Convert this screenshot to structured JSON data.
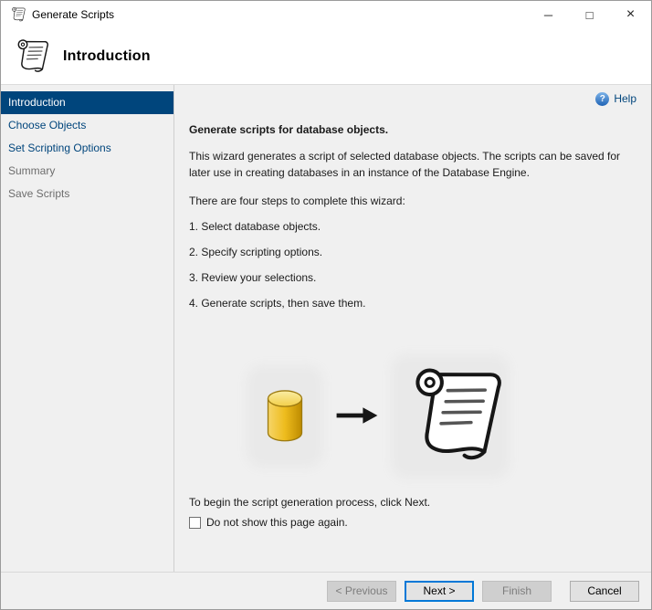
{
  "window": {
    "title": "Generate Scripts"
  },
  "icons": {
    "minimize": "─",
    "maximize": "□",
    "close": "×",
    "help_glyph": "?"
  },
  "header": {
    "title": "Introduction"
  },
  "sidebar": {
    "items": [
      {
        "label": "Introduction",
        "state": "selected"
      },
      {
        "label": "Choose Objects",
        "state": "visited"
      },
      {
        "label": "Set Scripting Options",
        "state": "visited"
      },
      {
        "label": "Summary",
        "state": "future"
      },
      {
        "label": "Save Scripts",
        "state": "future"
      }
    ]
  },
  "content": {
    "help_label": "Help",
    "heading": "Generate scripts for database objects.",
    "intro": "This wizard generates a script of selected database objects. The scripts can be saved for later use in creating databases in an instance of the Database Engine.",
    "steps_intro": "There are four steps to complete this wizard:",
    "steps": [
      "1. Select database objects.",
      "2. Specify scripting options.",
      "3. Review your selections.",
      "4. Generate scripts, then save them."
    ],
    "closing": "To begin the script generation process, click Next.",
    "checkbox_label": "Do not show this page again.",
    "checkbox_checked": false
  },
  "buttons": {
    "previous": "< Previous",
    "next": "Next >",
    "finish": "Finish",
    "cancel": "Cancel"
  },
  "colors": {
    "accent": "#0078d7",
    "selected_step_bg": "#00457c",
    "database_yellow": "#eebc1d",
    "background": "#f0f0f0"
  }
}
